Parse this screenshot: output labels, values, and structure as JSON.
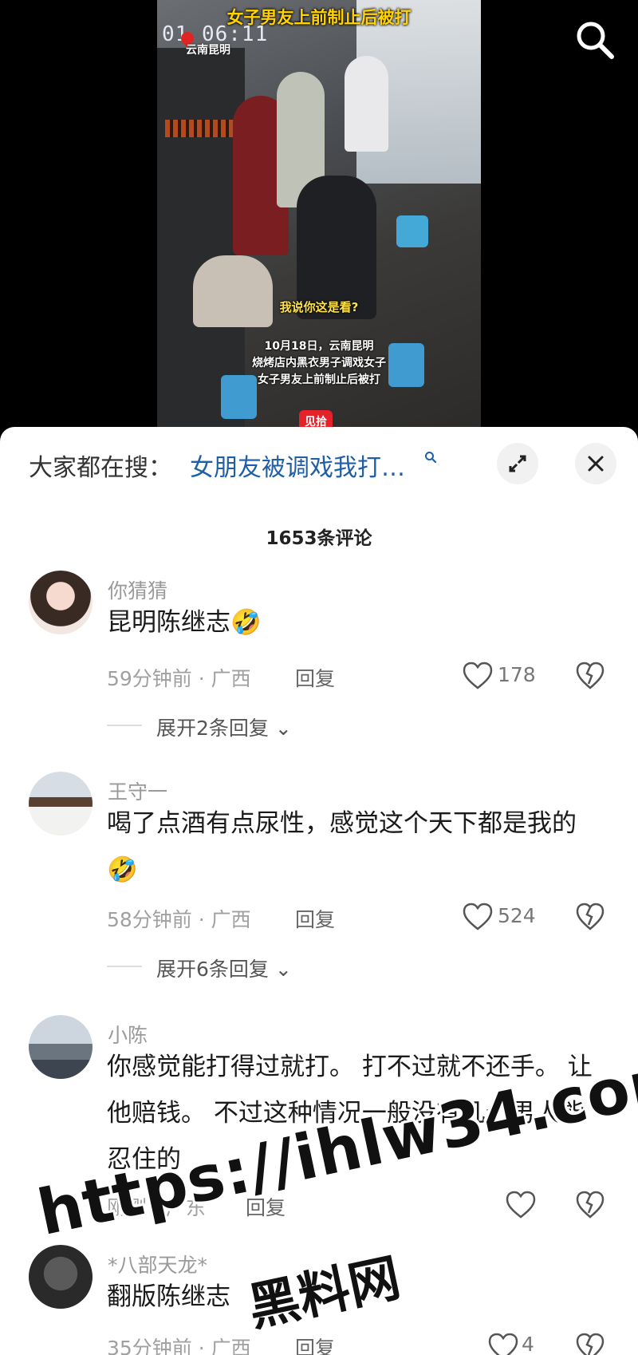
{
  "video": {
    "title": "女子男友上前制止后被打",
    "timestamp": "01 06:11",
    "location": "云南昆明",
    "quote": "我说你这是看?",
    "caption_lines": [
      "10月18日，云南昆明",
      "烧烤店内黑衣男子调戏女子",
      "女子男友上前制止后被打"
    ],
    "logo_text": "见拾"
  },
  "top_right": {
    "icon": "search-icon"
  },
  "search_hint": {
    "label": "大家都在搜：",
    "query": "女朋友被调戏我打…",
    "expand_icon": "expand-icon",
    "close_icon": "close-icon"
  },
  "comments_count": "1653条评论",
  "comments": [
    {
      "user": "你猜猜",
      "text": "昆明陈继志🤣",
      "time_region": "59分钟前 · 广西",
      "reply_label": "回复",
      "likes": "178",
      "expand": "展开2条回复"
    },
    {
      "user": "王守一",
      "text": "喝了点酒有点尿性，感觉这个天下都是我的🤣",
      "time_region": "58分钟前 · 广西",
      "reply_label": "回复",
      "likes": "524",
      "expand": "展开6条回复"
    },
    {
      "user": "小陈",
      "text": "你感觉能打得过就打。 打不过就不还手。 让他赔钱。 不过这种情况一般没有几个男人能忍住的",
      "time_region": "刚刚 · 广东",
      "reply_label": "回复",
      "likes": ""
    },
    {
      "user": "*八部天龙*",
      "text": "翻版陈继志",
      "time_region": "35分钟前 · 广西",
      "reply_label": "回复",
      "likes": "4"
    }
  ],
  "watermark": {
    "line1": "https://ihlw34.com",
    "line2": "黑料网"
  },
  "colors": {
    "accent_link": "#1f5fa8",
    "sheet_bg": "#ffffff",
    "video_title": "#ffd200"
  }
}
